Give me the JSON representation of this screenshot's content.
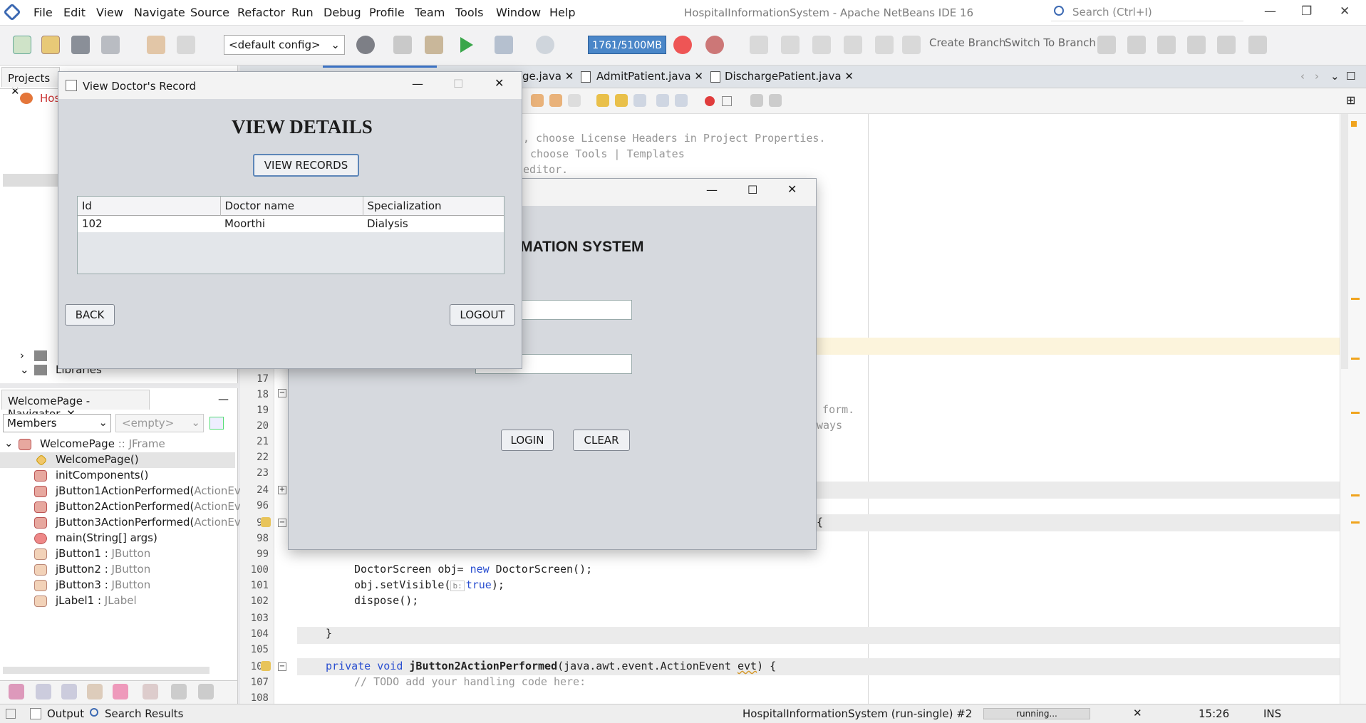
{
  "menubar": {
    "items": [
      "File",
      "Edit",
      "View",
      "Navigate",
      "Source",
      "Refactor",
      "Run",
      "Debug",
      "Profile",
      "Team",
      "Tools",
      "Window",
      "Help"
    ],
    "app_title": "HospitalInformationSystem - Apache NetBeans IDE 16",
    "search_placeholder": "Search (Ctrl+I)"
  },
  "toolbar": {
    "config": "<default config>",
    "memory": "1761/5100MB",
    "create_branch": "Create Branch",
    "switch_branch": "Switch To Branch"
  },
  "projects": {
    "tab": "Projects",
    "root": "Hos",
    "libraries": "Libraries"
  },
  "navigator": {
    "tab": "WelcomePage - Navigator",
    "filter": "Members",
    "filter2": "<empty>",
    "root": "WelcomePage",
    "root_type": ":: JFrame",
    "members": [
      {
        "name": "WelcomePage()",
        "type": ""
      },
      {
        "name": "initComponents()",
        "type": ""
      },
      {
        "name": "jButton1ActionPerformed(",
        "type": "ActionEvent"
      },
      {
        "name": "jButton2ActionPerformed(",
        "type": "ActionEvent"
      },
      {
        "name": "jButton3ActionPerformed(",
        "type": "ActionEvent"
      },
      {
        "name": "main(String[] args)",
        "type": ""
      },
      {
        "name": "jButton1 : ",
        "type": "JButton"
      },
      {
        "name": "jButton2 : ",
        "type": "JButton"
      },
      {
        "name": "jButton3 : ",
        "type": "JButton"
      },
      {
        "name": "jLabel1 : ",
        "type": "JLabel"
      }
    ]
  },
  "editor_tabs": [
    "ge.java",
    "AdmitPatient.java",
    "DischargePatient.java"
  ],
  "code": {
    "comment1": ", choose License Headers in Project Properties.",
    "comment2": "choose Tools | Templates",
    "comment3": "editor.",
    "frag1": "e form.",
    "frag2": "ways",
    "brace": "{",
    "l100": "DoctorScreen obj= ",
    "l100_kw": "new",
    "l100_b": " DoctorScreen();",
    "l101_a": "obj.setVisible(",
    "l101_hint": "b:",
    "l101_kw": "true",
    "l101_b": ");",
    "l102": "dispose();",
    "l104": "}",
    "l106_a": "private void",
    "l106_b": " jButton2ActionPerformed",
    "l106_c": "(java.awt.event.ActionEvent ",
    "l106_d": "evt",
    "l106_e": ") {",
    "l107": "// TODO add your handling code here:"
  },
  "line_numbers": [
    "17",
    "18",
    "19",
    "20",
    "21",
    "22",
    "23",
    "24",
    "96",
    "97",
    "98",
    "99",
    "100",
    "101",
    "102",
    "103",
    "104",
    "105",
    "106",
    "107",
    "108"
  ],
  "login_dialog": {
    "heading": "MATION SYSTEM",
    "login": "LOGIN",
    "clear": "CLEAR"
  },
  "doctor_dialog": {
    "title": "View Doctor's Record",
    "heading": "VIEW DETAILS",
    "view_records": "VIEW RECORDS",
    "columns": [
      "Id",
      "Doctor name",
      "Specialization"
    ],
    "rows": [
      [
        "102",
        "Moorthi",
        "Dialysis"
      ]
    ],
    "back": "BACK",
    "logout": "LOGOUT"
  },
  "statusbar": {
    "output": "Output",
    "search_results": "Search Results",
    "run_label": "HospitalInformationSystem (run-single) #2",
    "progress": "running...",
    "time": "15:26",
    "mode": "INS"
  }
}
